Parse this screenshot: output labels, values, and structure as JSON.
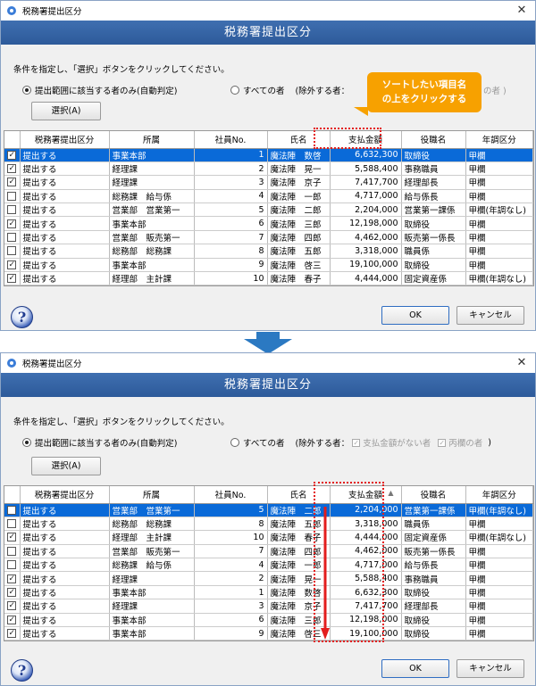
{
  "window_title": "税務署提出区分",
  "header": "税務署提出区分",
  "instruction": "条件を指定し、「選択」ボタンをクリックしてください。",
  "options": {
    "option1": "提出範囲に該当する者のみ(自動判定)",
    "option2": "すべての者",
    "exclude_label": "(除外する者：",
    "exclude1": "支払金額がない者",
    "exclude2": "丙欄の者",
    "exclude_close": ")",
    "w1_exclude_tail": "の者 )"
  },
  "select_button": "選択(A)",
  "ok_button": "OK",
  "cancel_button": "キャンセル",
  "help_icon_label": "?",
  "callout": {
    "line1": "ソートしたい項目名",
    "line2": "の上をクリックする"
  },
  "columns": [
    "税務署提出区分",
    "所属",
    "社員No.",
    "氏名",
    "支払金額",
    "役職名",
    "年調区分"
  ],
  "table1": [
    {
      "checked": true,
      "submit": "提出する",
      "dept": "事業本部",
      "no": "1",
      "name": "魔法陣　数啓",
      "pay": "6,632,300",
      "title": "取締役",
      "kubun": "甲欄",
      "selected": true
    },
    {
      "checked": true,
      "submit": "提出する",
      "dept": "経理課",
      "no": "2",
      "name": "魔法陣　晃一",
      "pay": "5,588,400",
      "title": "事務職員",
      "kubun": "甲欄"
    },
    {
      "checked": true,
      "submit": "提出する",
      "dept": "経理課",
      "no": "3",
      "name": "魔法陣　京子",
      "pay": "7,417,700",
      "title": "経理部長",
      "kubun": "甲欄"
    },
    {
      "checked": false,
      "submit": "提出する",
      "dept": "総務課　給与係",
      "no": "4",
      "name": "魔法陣　一郎",
      "pay": "4,717,000",
      "title": "給与係長",
      "kubun": "甲欄"
    },
    {
      "checked": false,
      "submit": "提出する",
      "dept": "営業部　営業第一",
      "no": "5",
      "name": "魔法陣　二郎",
      "pay": "2,204,000",
      "title": "営業第一課係",
      "kubun": "甲欄(年調なし)"
    },
    {
      "checked": true,
      "submit": "提出する",
      "dept": "事業本部",
      "no": "6",
      "name": "魔法陣　三郎",
      "pay": "12,198,000",
      "title": "取締役",
      "kubun": "甲欄"
    },
    {
      "checked": false,
      "submit": "提出する",
      "dept": "営業部　販売第一",
      "no": "7",
      "name": "魔法陣　四郎",
      "pay": "4,462,000",
      "title": "販売第一係長",
      "kubun": "甲欄"
    },
    {
      "checked": false,
      "submit": "提出する",
      "dept": "総務部　総務課",
      "no": "8",
      "name": "魔法陣　五郎",
      "pay": "3,318,000",
      "title": "職員係",
      "kubun": "甲欄"
    },
    {
      "checked": true,
      "submit": "提出する",
      "dept": "事業本部",
      "no": "9",
      "name": "魔法陣　啓三",
      "pay": "19,100,000",
      "title": "取締役",
      "kubun": "甲欄"
    },
    {
      "checked": true,
      "submit": "提出する",
      "dept": "経理部　主計課",
      "no": "10",
      "name": "魔法陣　春子",
      "pay": "4,444,000",
      "title": "固定資産係",
      "kubun": "甲欄(年調なし)"
    }
  ],
  "table2": [
    {
      "checked": false,
      "submit": "提出する",
      "dept": "営業部　営業第一",
      "no": "5",
      "name": "魔法陣　二郎",
      "pay": "2,204,000",
      "title": "営業第一課係",
      "kubun": "甲欄(年調なし)",
      "selected": true
    },
    {
      "checked": false,
      "submit": "提出する",
      "dept": "総務部　総務課",
      "no": "8",
      "name": "魔法陣　五郎",
      "pay": "3,318,000",
      "title": "職員係",
      "kubun": "甲欄"
    },
    {
      "checked": true,
      "submit": "提出する",
      "dept": "経理部　主計課",
      "no": "10",
      "name": "魔法陣　春子",
      "pay": "4,444,000",
      "title": "固定資産係",
      "kubun": "甲欄(年調なし)"
    },
    {
      "checked": false,
      "submit": "提出する",
      "dept": "営業部　販売第一",
      "no": "7",
      "name": "魔法陣　四郎",
      "pay": "4,462,000",
      "title": "販売第一係長",
      "kubun": "甲欄"
    },
    {
      "checked": false,
      "submit": "提出する",
      "dept": "総務課　給与係",
      "no": "4",
      "name": "魔法陣　一郎",
      "pay": "4,717,000",
      "title": "給与係長",
      "kubun": "甲欄"
    },
    {
      "checked": true,
      "submit": "提出する",
      "dept": "経理課",
      "no": "2",
      "name": "魔法陣　晃一",
      "pay": "5,588,400",
      "title": "事務職員",
      "kubun": "甲欄"
    },
    {
      "checked": true,
      "submit": "提出する",
      "dept": "事業本部",
      "no": "1",
      "name": "魔法陣　数啓",
      "pay": "6,632,300",
      "title": "取締役",
      "kubun": "甲欄"
    },
    {
      "checked": true,
      "submit": "提出する",
      "dept": "経理課",
      "no": "3",
      "name": "魔法陣　京子",
      "pay": "7,417,700",
      "title": "経理部長",
      "kubun": "甲欄"
    },
    {
      "checked": true,
      "submit": "提出する",
      "dept": "事業本部",
      "no": "6",
      "name": "魔法陣　三郎",
      "pay": "12,198,000",
      "title": "取締役",
      "kubun": "甲欄"
    },
    {
      "checked": true,
      "submit": "提出する",
      "dept": "事業本部",
      "no": "9",
      "name": "魔法陣　啓三",
      "pay": "19,100,000",
      "title": "取締役",
      "kubun": "甲欄"
    }
  ],
  "sort_indicator": "▲",
  "colors": {
    "banner": "#2d5a9a",
    "selection": "#0a6ad8",
    "callout": "#f7a100",
    "arrow": "#2b79c2",
    "annotation": "#e31d1d"
  }
}
